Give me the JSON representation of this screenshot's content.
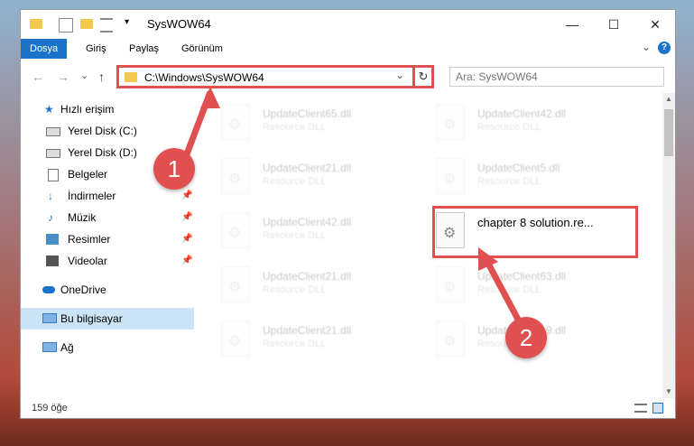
{
  "window": {
    "title": "SysWOW64",
    "controls": {
      "minimize": "—",
      "maximize": "☐",
      "close": "✕"
    }
  },
  "ribbon": {
    "tabs": [
      "Dosya",
      "Giriş",
      "Paylaş",
      "Görünüm"
    ],
    "help": "?",
    "expand": "⌄"
  },
  "addressbar": {
    "path": "C:\\Windows\\SysWOW64",
    "search_placeholder": "Ara: SysWOW64",
    "refresh": "↻",
    "dropdown": "⌄",
    "back": "←",
    "forward": "→",
    "recent": "⌄",
    "up": "↑"
  },
  "nav": {
    "items": [
      {
        "label": "Hızlı erişim",
        "icon": "star-icon"
      },
      {
        "label": "Yerel Disk (C:)",
        "icon": "drive-icon"
      },
      {
        "label": "Yerel Disk (D:)",
        "icon": "drive-icon"
      },
      {
        "label": "Belgeler",
        "icon": "documents-icon"
      },
      {
        "label": "İndirmeler",
        "icon": "download-icon"
      },
      {
        "label": "Müzik",
        "icon": "music-icon"
      },
      {
        "label": "Resimler",
        "icon": "pictures-icon"
      },
      {
        "label": "Videolar",
        "icon": "videos-icon"
      },
      {
        "label": "OneDrive",
        "icon": "cloud-icon"
      },
      {
        "label": "Bu bilgisayar",
        "icon": "computer-icon"
      },
      {
        "label": "Ağ",
        "icon": "network-icon"
      }
    ]
  },
  "files": {
    "col1": [
      {
        "name": "UpdateClient65.dll",
        "type": "Resource DLL"
      },
      {
        "name": "UpdateClient21.dll",
        "type": "Resource DLL"
      },
      {
        "name": "UpdateClient42.dll",
        "type": "Resource DLL"
      },
      {
        "name": "UpdateClient21.dll",
        "type": "Resource DLL"
      },
      {
        "name": "UpdateClient21.dll",
        "type": "Resource DLL"
      }
    ],
    "col2": [
      {
        "name": "UpdateClient42.dll",
        "type": "Resource DLL"
      },
      {
        "name": "UpdateClient5.dll",
        "type": "Resource DLL"
      },
      {
        "name": "chapter 8 solution.re...",
        "type": ""
      },
      {
        "name": "UpdateClient63.dll",
        "type": "Resource DLL"
      },
      {
        "name": "UpdateClient19.dll",
        "type": "Resource DLL"
      }
    ]
  },
  "status": {
    "count": "159 öğe"
  },
  "badges": {
    "one": "1",
    "two": "2"
  },
  "colors": {
    "accent": "#1a73c8",
    "highlight": "#e05050"
  }
}
